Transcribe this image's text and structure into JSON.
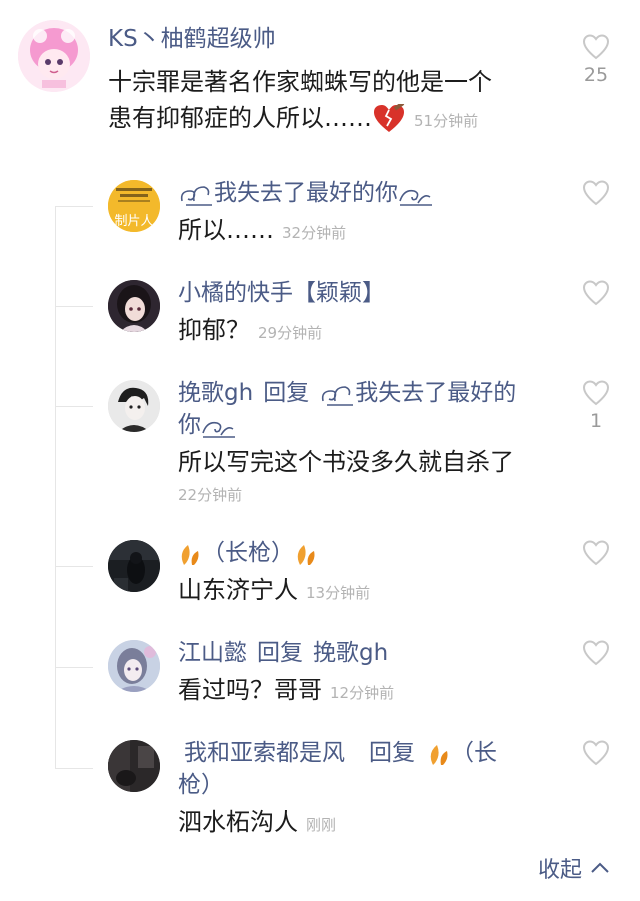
{
  "main_comment": {
    "user": "KS丶柚鹤超级帅",
    "text_line1": "十宗罪是著名作家蜘蛛写的他是一个",
    "text_line2": "患有抑郁症的人所以……",
    "time": "51分钟前",
    "likes": "25"
  },
  "replies": [
    {
      "user": "我失去了最好的你",
      "text": "所以……",
      "time": "32分钟前",
      "avatar_label": "制片人"
    },
    {
      "user": "小橘的快手【颖颖】",
      "text": "抑郁？",
      "time": "29分钟前"
    },
    {
      "user": "挽歌gh",
      "reply_word": "回复",
      "reply_to_a": "我失去了最好的",
      "reply_to_b": "你",
      "text": "所以写完这个书没多久就自杀了",
      "time": "22分钟前",
      "likes": "1"
    },
    {
      "user": "（长枪）",
      "text": "山东济宁人",
      "time": "13分钟前"
    },
    {
      "user": "江山懿",
      "reply_word": "回复",
      "reply_to": "挽歌gh",
      "text": "看过吗？哥哥",
      "time": "12分钟前"
    },
    {
      "user": "我和亚索都是风",
      "reply_word": "回复",
      "reply_to_a": "（长",
      "reply_to_b": "枪）",
      "text": "泗水柘沟人",
      "time": "刚刚"
    }
  ],
  "footer": {
    "collapse_label": "收起"
  },
  "colors": {
    "name": "#4b5b86",
    "text": "#1c1c1c",
    "time": "#b3b3b3",
    "leaf": "#f0a030"
  }
}
